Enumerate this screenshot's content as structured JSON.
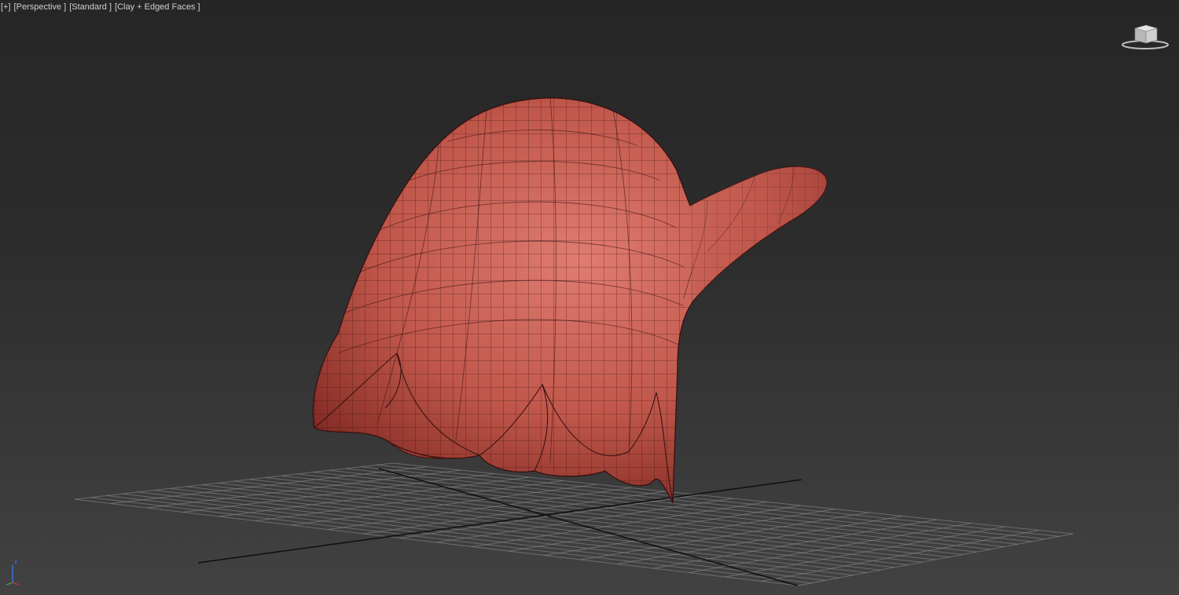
{
  "viewport": {
    "menu_label": "[+]",
    "view_label": "[Perspective ]",
    "shading_label": "[Standard ]",
    "display_label": "[Clay + Edged Faces ]"
  },
  "axis": {
    "z_label": "z"
  },
  "colors": {
    "background_top": "#262626",
    "background_bottom": "#424242",
    "model_fill": "#c25649",
    "model_wire": "#3a1212",
    "grid_line": "#8a8a8a",
    "grid_axis": "#111111",
    "label_text": "#cfcfcf"
  },
  "icons": {
    "viewcube": "viewcube-icon",
    "axis": "axis-tripod-icon"
  }
}
